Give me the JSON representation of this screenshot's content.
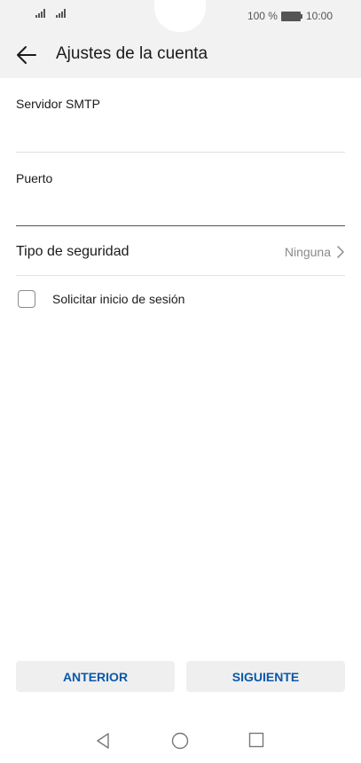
{
  "status_bar": {
    "battery_percent": "100 %",
    "time": "10:00",
    "icons": [
      "signal-icon",
      "signal-icon",
      "battery-icon"
    ]
  },
  "header": {
    "title": "Ajustes de la cuenta",
    "back_icon": "arrow-left-icon"
  },
  "fields": {
    "smtp_server": {
      "label": "Servidor SMTP",
      "value": ""
    },
    "port": {
      "label": "Puerto",
      "value": ""
    }
  },
  "security": {
    "label": "Tipo de seguridad",
    "value": "Ninguna",
    "icon": "chevron-right-icon"
  },
  "login_option": {
    "label": "Solicitar inicio de sesión",
    "checked": false
  },
  "buttons": {
    "previous": "ANTERIOR",
    "next": "SIGUIENTE"
  },
  "nav_bar": {
    "icons": [
      "back-triangle-icon",
      "home-circle-icon",
      "recents-square-icon"
    ]
  },
  "colors": {
    "accent": "#0a59a8",
    "header_bg": "#f2f2f2",
    "button_bg": "#efefef"
  }
}
